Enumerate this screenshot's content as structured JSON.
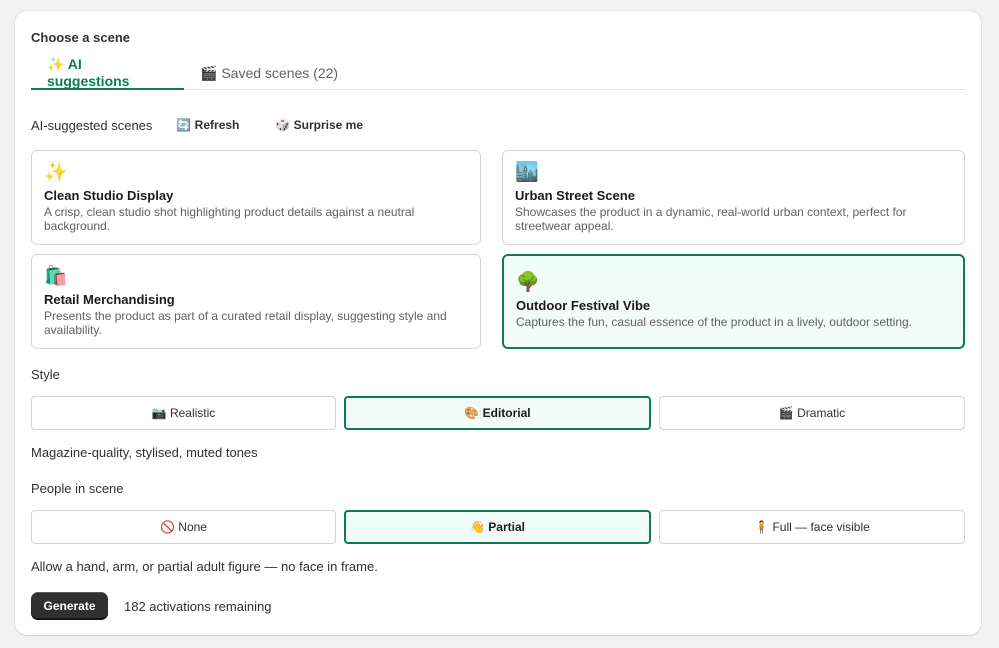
{
  "heading": "Choose a scene",
  "tabs": [
    {
      "label": "✨ AI suggestions",
      "active": true
    },
    {
      "label": "🎬 Saved scenes (22)",
      "active": false
    }
  ],
  "suggestions": {
    "label": "AI-suggested scenes",
    "refresh_label": "🔄 Refresh",
    "surprise_label": "🎲 Surprise me"
  },
  "scenes": [
    {
      "emoji": "✨",
      "title": "Clean Studio Display",
      "desc": "A crisp, clean studio shot highlighting product details against a neutral background."
    },
    {
      "emoji": "🏙️",
      "title": "Urban Street Scene",
      "desc": "Showcases the product in a dynamic, real-world urban context, perfect for streetwear appeal."
    },
    {
      "emoji": "🛍️",
      "title": "Retail Merchandising",
      "desc": "Presents the product as part of a curated retail display, suggesting style and availability."
    },
    {
      "emoji": "🌳",
      "title": "Outdoor Festival Vibe",
      "desc": "Captures the fun, casual essence of the product in a lively, outdoor setting.",
      "selected": true
    }
  ],
  "style": {
    "label": "Style",
    "options": [
      "📷 Realistic",
      "🎨 Editorial",
      "🎬 Dramatic"
    ],
    "selected": "🎨 Editorial",
    "helper": "Magazine-quality, stylised, muted tones"
  },
  "people": {
    "label": "People in scene",
    "options": [
      "🚫 None",
      "👋 Partial",
      "🧍 Full — face visible"
    ],
    "selected": "👋 Partial",
    "helper": "Allow a hand, arm, or partial adult figure — no face in frame."
  },
  "footer": {
    "generate_label": "Generate",
    "remaining": "182 activations remaining"
  },
  "colors": {
    "accent": "#0e7a5a",
    "selected_bg": "#f1fcf8",
    "button_dark": "#303030"
  }
}
